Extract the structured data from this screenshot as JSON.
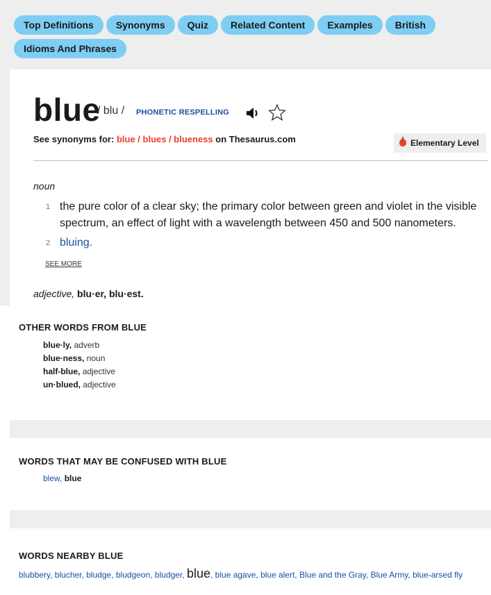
{
  "nav": {
    "pills": [
      "Top Definitions",
      "Synonyms",
      "Quiz",
      "Related Content",
      "Examples",
      "British",
      "Idioms And Phrases"
    ]
  },
  "entry": {
    "word": "blue",
    "pronunciation": "/ blu /",
    "phonetic_label": "PHONETIC RESPELLING",
    "see_synonyms_prefix": "See synonyms for:",
    "see_synonyms_links": "blue / blues / blueness",
    "see_synonyms_suffix": "on Thesaurus.com",
    "level": "Elementary Level",
    "part_of_speech": "noun",
    "definitions": [
      {
        "num": "1",
        "text": "the pure color of a clear sky; the primary color between green and violet in the visible spectrum, an effect of light with a wavelength between 450 and 500 nanometers."
      },
      {
        "num": "2",
        "text": "bluing."
      }
    ],
    "see_more": "SEE MORE",
    "adj_pos": "adjective,",
    "adj_forms": "blu·er, blu·est."
  },
  "other_words": {
    "title": "OTHER WORDS FROM BLUE",
    "items": [
      {
        "word": "blue·ly,",
        "pos": "adverb"
      },
      {
        "word": "blue·ness,",
        "pos": "noun"
      },
      {
        "word": "half-blue,",
        "pos": "adjective"
      },
      {
        "word": "un·blued,",
        "pos": "adjective"
      }
    ]
  },
  "confused": {
    "title": "WORDS THAT MAY BE CONFUSED WITH BLUE",
    "link": "blew,",
    "current": "blue"
  },
  "nearby": {
    "title": "WORDS NEARBY BLUE",
    "before": "blubbery, blucher, bludge, bludgeon, bludger,",
    "current": "blue",
    "after": ", blue agave, blue alert, Blue and the Gray, Blue Army, blue-arsed fly"
  },
  "colors": {
    "pill_bg": "#7ecdf3",
    "link_blue": "#1a4fa3",
    "accent_red": "#e5412d",
    "panel_gray": "#eeeeee"
  },
  "icons": [
    "speaker-icon",
    "star-icon",
    "apple-icon"
  ]
}
